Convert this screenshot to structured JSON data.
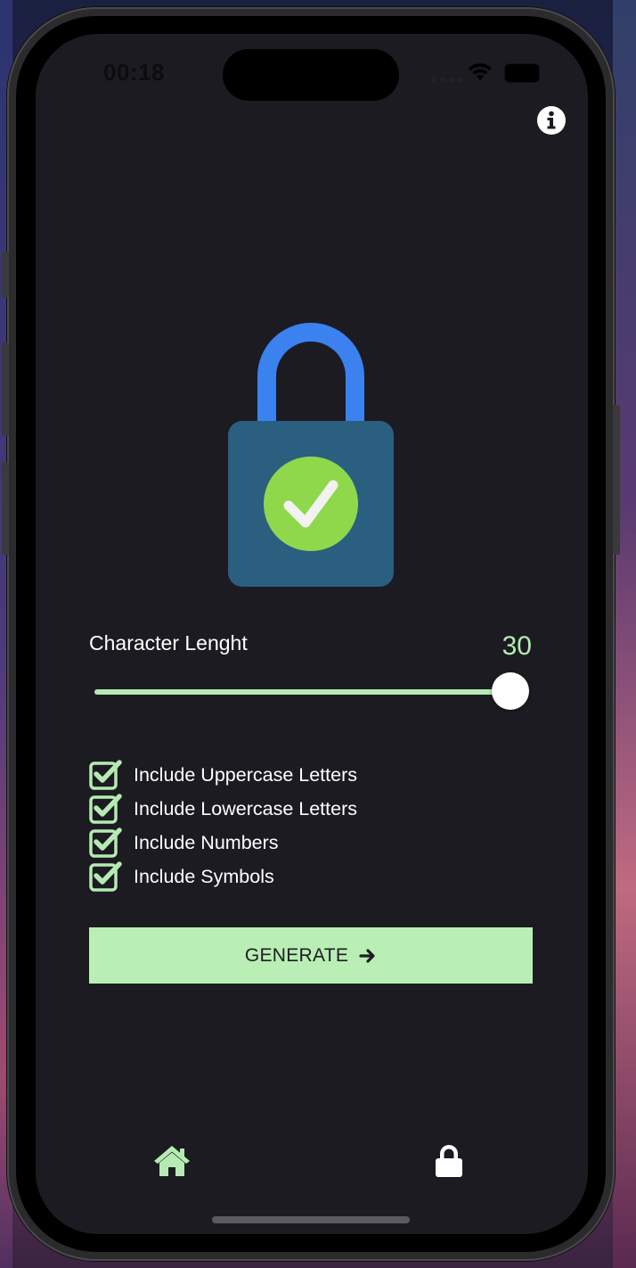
{
  "status_bar": {
    "time": "00:18"
  },
  "header": {
    "info_icon": "info-circle-icon"
  },
  "illustration": {
    "icon": "padlock-checkmark-icon",
    "colors": {
      "shackle": "#3b82f0",
      "body": "#2a5f80",
      "check_circle": "#8fd84c"
    }
  },
  "length": {
    "label": "Character Lenght",
    "value": "30",
    "fraction": 1.0
  },
  "options": [
    {
      "label": "Include Uppercase Letters",
      "checked": true
    },
    {
      "label": "Include Lowercase Letters",
      "checked": true
    },
    {
      "label": "Include Numbers",
      "checked": true
    },
    {
      "label": "Include Symbols",
      "checked": true
    }
  ],
  "generate": {
    "label": "GENERATE",
    "icon": "arrow-right-icon"
  },
  "tab_bar": {
    "items": [
      {
        "icon": "home-icon",
        "active": true
      },
      {
        "icon": "lock-icon",
        "active": false
      }
    ]
  },
  "colors": {
    "accent": "#b5ebb2",
    "background": "#1c1b21",
    "button": "#b9eeb5"
  }
}
